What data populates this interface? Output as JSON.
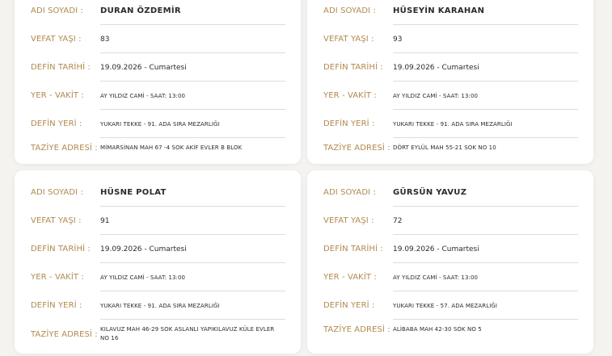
{
  "labels": {
    "name": "ADI SOYADI :",
    "age": "VEFAT YAŞI :",
    "date": "DEFİN TARİHİ :",
    "time": "YER - VAKİT :",
    "place": "DEFİN YERİ :",
    "address": "TAZİYE ADRESİ :"
  },
  "cards": [
    {
      "name": "DURAN ÖZDEMİR",
      "age": "83",
      "date": "19.09.2026 - Cumartesi",
      "time": "AY YILDIZ CAMİ - SAAT: 13:00",
      "place": "YUKARI TEKKE - 91. ADA SIRA MEZARLIĞI",
      "address": "MİMARSİNAN MAH 67 -4 SOK AKİF EVLER B BLOK"
    },
    {
      "name": "HÜSEYİN KARAHAN",
      "age": "93",
      "date": "19.09.2026 - Cumartesi",
      "time": "AY YILDIZ CAMİ - SAAT: 13:00",
      "place": "YUKARI TEKKE - 91. ADA SIRA MEZARLIĞI",
      "address": "DÖRT EYLÜL MAH 55-21 SOK NO 10"
    },
    {
      "name": "HÜSNE POLAT",
      "age": "91",
      "date": "19.09.2026 - Cumartesi",
      "time": "AY YILDIZ CAMİ - SAAT: 13:00",
      "place": "YUKARI TEKKE - 91. ADA SIRA MEZARLIĞI",
      "address": "KILAVUZ MAH 46-29 SOK ASLANLI YAPIKILAVUZ KÜLE EVLER NO 16"
    },
    {
      "name": "GÜRSÜN YAVUZ",
      "age": "72",
      "date": "19.09.2026 - Cumartesi",
      "time": "AY YILDIZ CAMİ - SAAT: 13:00",
      "place": "YUKARI TEKKE - 57. ADA MEZARLIĞI",
      "address": "ALİBABA MAH 42-30 SOK NO 5"
    }
  ],
  "colors": {
    "label": "#b08a4e",
    "value": "#2b2b2b",
    "background": "#f5f3f0",
    "card": "#ffffff"
  }
}
